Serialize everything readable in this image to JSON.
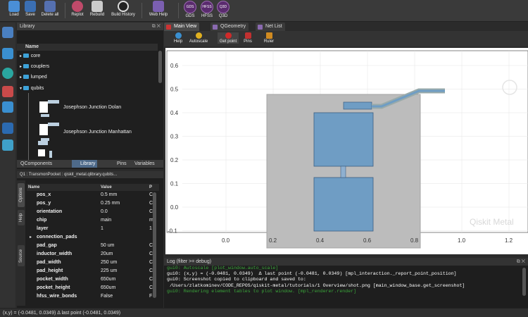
{
  "toolbar": {
    "buttons": [
      {
        "label": "Load",
        "icon": "folder-open-icon"
      },
      {
        "label": "Save",
        "icon": "save-icon"
      },
      {
        "label": "Delete all",
        "icon": "delete-all-icon"
      },
      {
        "label": "Replot",
        "icon": "replot-icon"
      },
      {
        "label": "Rebuild",
        "icon": "rebuild-icon"
      },
      {
        "label": "Build History",
        "icon": "history-icon"
      },
      {
        "label": "Web Help",
        "icon": "web-help-icon"
      }
    ],
    "renderers": [
      {
        "label": "GDS",
        "caption": "GDS"
      },
      {
        "label": "HFSS",
        "caption": "HFSS"
      },
      {
        "label": "Q3D",
        "caption": "Q3D"
      }
    ]
  },
  "library": {
    "title": "Library",
    "column_header": "Name",
    "folders": [
      "core",
      "couplers",
      "lumped",
      "qubits"
    ],
    "components": [
      "Josephson Junction Dolan",
      "Josephson Junction Manhattan"
    ]
  },
  "left_tabs": [
    "QComponents",
    "Library",
    "Pins",
    "Variables"
  ],
  "options": {
    "q1_label": "Q1  :  TransmonPocket  :  qiskit_metal.qlibrary.qubits...",
    "side_tabs": [
      "Options",
      "Help",
      "Source"
    ],
    "headers": {
      "name": "Name",
      "value": "Value",
      "unit": "P"
    },
    "rows": [
      {
        "name": "pos_x",
        "value": "0.5 mm",
        "unit": "C"
      },
      {
        "name": "pos_y",
        "value": "0.25 mm",
        "unit": "C"
      },
      {
        "name": "orientation",
        "value": "0.0",
        "unit": "C"
      },
      {
        "name": "chip",
        "value": "main",
        "unit": "m"
      },
      {
        "name": "layer",
        "value": "1",
        "unit": "1"
      },
      {
        "name": "connection_pads",
        "value": "",
        "unit": ""
      },
      {
        "name": "pad_gap",
        "value": "50 um",
        "unit": "C"
      },
      {
        "name": "inductor_width",
        "value": "20um",
        "unit": "C"
      },
      {
        "name": "pad_width",
        "value": "250 um",
        "unit": "C"
      },
      {
        "name": "pad_height",
        "value": "225 um",
        "unit": "C"
      },
      {
        "name": "pocket_width",
        "value": "650um",
        "unit": "C"
      },
      {
        "name": "pocket_height",
        "value": "650um",
        "unit": "C"
      },
      {
        "name": "hfss_wire_bonds",
        "value": "False",
        "unit": "F"
      }
    ]
  },
  "plot": {
    "tabs": [
      "Main View",
      "QGeometry",
      "Net List"
    ],
    "tools": [
      "Help",
      "Autoscale",
      "Get point",
      "Pins",
      "Ruler"
    ],
    "x_ticks": [
      "0.0",
      "0.2",
      "0.4",
      "0.6",
      "0.8",
      "1.0",
      "1.2"
    ],
    "y_ticks": [
      "0.6",
      "0.5",
      "0.4",
      "0.3",
      "0.2",
      "0.1",
      "0.0",
      "-0.1"
    ],
    "watermark": "Qiskit Metal"
  },
  "log": {
    "title": "Log  (filter >= debug)",
    "lines": [
      {
        "text": "gui0: Autoscale [plot_window.auto_scale]",
        "color": "#3ba83b"
      },
      {
        "text": "gui0: (x,y) = (-0.0481, 0.0349)  Δ last point (-0.0481, 0.0349) [mpl_interaction._report_point_position]",
        "color": "#ffffff"
      },
      {
        "text": "gui0: Screenshot copied to clipboard and saved to:",
        "color": "#ffffff"
      },
      {
        "text": " /Users/zlatkominev/CODE_REPOS/qiskit-metal/tutorials/1 Overview/shot.png [main_window_base.get_screenshot]",
        "color": "#ffffff"
      },
      {
        "text": "",
        "color": "#ffffff"
      },
      {
        "text": "gui0: Rendering element tables to plot window. [mpl_renderer.render]",
        "color": "#3ba83b"
      }
    ]
  },
  "status": "(x,y) = (-0.0481, 0.0349)  Δ last point (-0.0481, 0.0349)"
}
